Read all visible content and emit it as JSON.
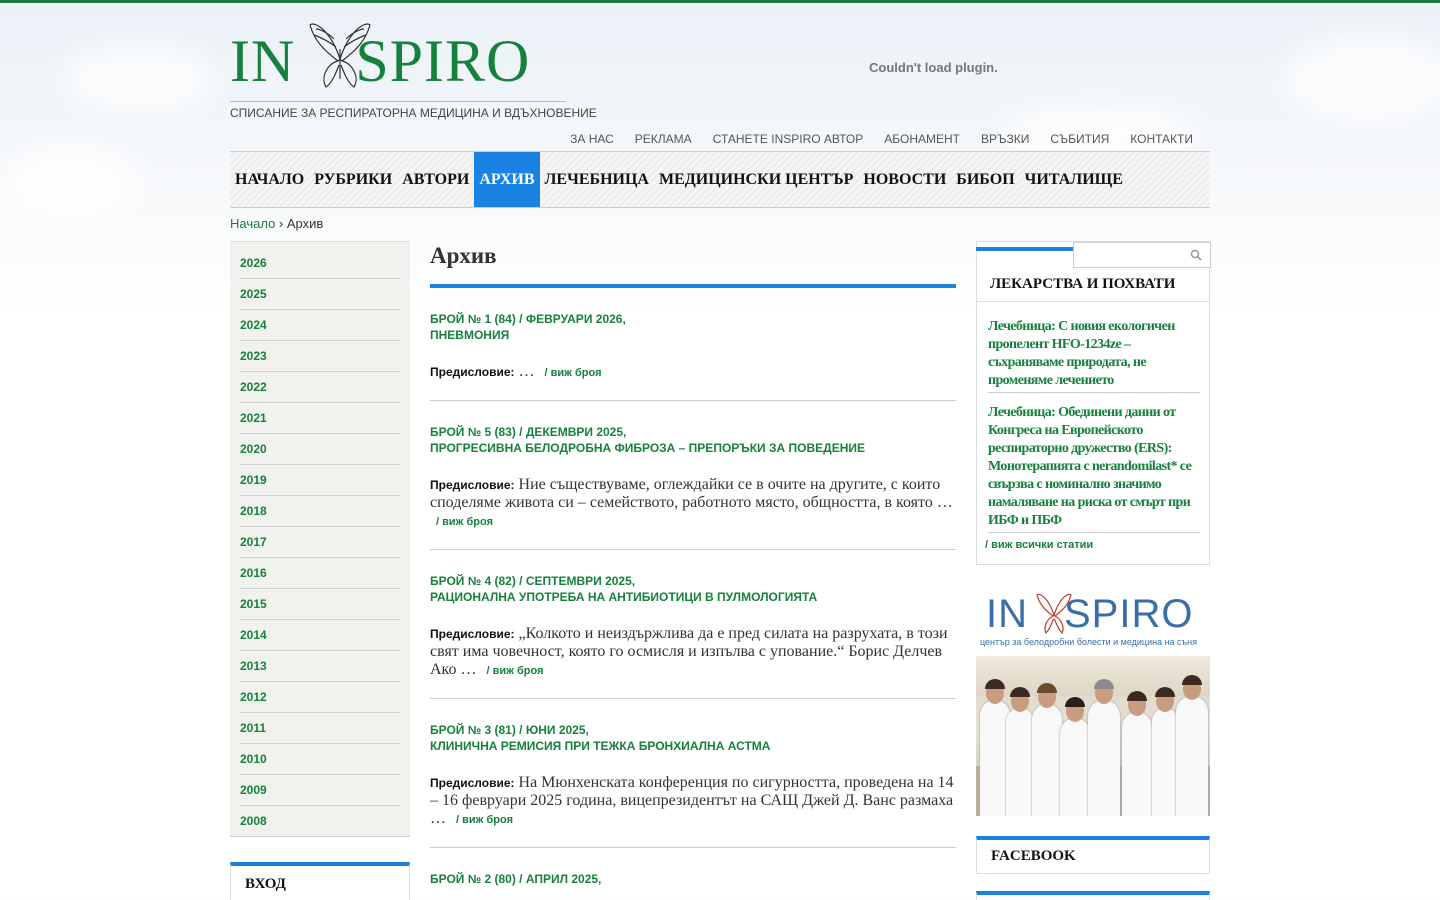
{
  "logo": {
    "left_text": "IN",
    "right_text": "SPIRO",
    "tagline": "СПИСАНИЕ ЗА РЕСПИРАТОРНА МЕДИЦИНА И ВДЪХНОВЕНИЕ",
    "brand_color": "#16813d"
  },
  "plugin_message": "Couldn't load plugin.",
  "top_nav": [
    "ЗА НАС",
    "РЕКЛАМА",
    "СТАНЕТЕ INSPIRO АВТОР",
    "АБОНАМЕНТ",
    "ВРЪЗКИ",
    "СЪБИТИЯ",
    "КОНТАКТИ"
  ],
  "main_nav": {
    "items": [
      "НАЧАЛО",
      "РУБРИКИ",
      "АВТОРИ",
      "АРХИВ",
      "ЛЕЧЕБНИЦА",
      "МЕДИЦИНСКИ ЦЕНТЪР",
      "НОВОСТИ",
      "БИБОП",
      "ЧИТАЛИЩЕ"
    ],
    "active": "АРХИВ",
    "active_color": "#1a82e2"
  },
  "breadcrumb": {
    "home": "Начало",
    "separator": "›",
    "current": "Архив"
  },
  "years": [
    "2026",
    "2025",
    "2024",
    "2023",
    "2022",
    "2021",
    "2020",
    "2019",
    "2018",
    "2017",
    "2016",
    "2015",
    "2014",
    "2013",
    "2012",
    "2011",
    "2010",
    "2009",
    "2008"
  ],
  "login_title": "ВХОД",
  "archive": {
    "heading": "Архив",
    "preface_label": "Предисловие:",
    "more_label": "/ виж броя",
    "issues": [
      {
        "line1": "БРОЙ № 1 (84) / ФЕВРУАРИ 2026,",
        "line2": "ПНЕВМОНИЯ",
        "excerpt": "…"
      },
      {
        "line1": "БРОЙ № 5 (83) / ДЕКЕМВРИ 2025,",
        "line2": "ПРОГРЕСИВНА БЕЛОДРОБНА ФИБРОЗА – ПРЕПОРЪКИ ЗА ПОВЕДЕНИЕ",
        "excerpt": "Ние съществуваме, оглеждайки се в очите на другите, с които споделяме живота си – семейството, работното място, общността, в която …"
      },
      {
        "line1": "БРОЙ № 4 (82) / СЕПТЕМВРИ 2025,",
        "line2": "РАЦИОНАЛНА УПОТРЕБА НА АНТИБИОТИЦИ В ПУЛМОЛОГИЯТА",
        "excerpt": "„Колкото и неиздържлива да е пред силата на разрухата,  в този свят има човечност,  която го осмисля и изпълва с упование.“ Борис Делчев   Ако …"
      },
      {
        "line1": "БРОЙ № 3 (81) / ЮНИ 2025,",
        "line2": "КЛИНИЧНА РЕМИСИЯ ПРИ ТЕЖКА БРОНХИАЛНА АСТМА",
        "excerpt": "На Мюнхенската конференция по сигурността, проведена на 14 – 16 февруари 2025 година, вицепрезидентът на САЩ Джей Д. Ванс размаха …"
      },
      {
        "line1": "БРОЙ № 2 (80) / АПРИЛ 2025,",
        "line2": "",
        "excerpt": ""
      }
    ]
  },
  "sidebar": {
    "search_placeholder": "",
    "search_icon": "search-icon",
    "drugs_title": "ЛЕКАРСТВА И ПОХВАТИ",
    "articles": [
      "Лечебница: С новия екологичен пропелент HFO-1234ze – съхраняваме природата, не променяме лечението",
      "Лечебница: Обединени данни от Конгреса на Европейското респираторно дружество (ERS): Монотерапията с nerandomilast* се свързва с номинално значимо намаляване на риска от смърт при ИБФ и ПБФ"
    ],
    "all_articles": "/ виж всички статии",
    "promo": {
      "left_text": "IN",
      "right_text": "SPIRO",
      "subtitle": "център за белодробни болести и медицина на съня",
      "brand_color": "#3a6ea8"
    },
    "facebook_title": "FACEBOOK"
  }
}
